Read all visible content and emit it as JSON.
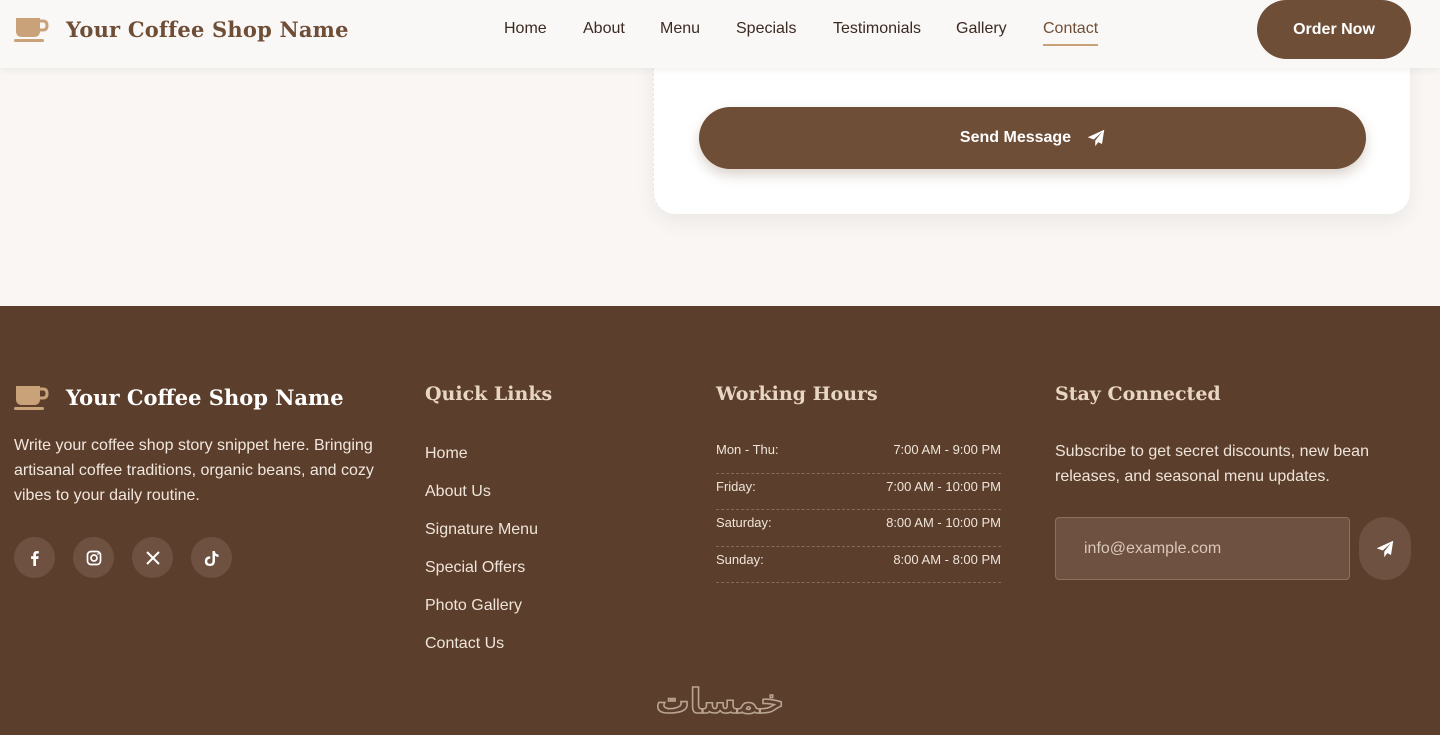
{
  "header": {
    "brand_name": "Your Coffee Shop Name",
    "nav": [
      {
        "label": "Home"
      },
      {
        "label": "About"
      },
      {
        "label": "Menu"
      },
      {
        "label": "Specials"
      },
      {
        "label": "Testimonials"
      },
      {
        "label": "Gallery"
      },
      {
        "label": "Contact",
        "active": true
      }
    ],
    "order_button": "Order Now"
  },
  "contact_form": {
    "send_button": "Send Message"
  },
  "footer": {
    "brand_name": "Your Coffee Shop Name",
    "story": "Write your coffee shop story snippet here. Bringing artisanal coffee traditions, organic beans, and cozy vibes to your daily routine.",
    "socials": [
      "facebook-icon",
      "instagram-icon",
      "x-icon",
      "tiktok-icon"
    ],
    "quick_links": {
      "title": "Quick Links",
      "items": [
        "Home",
        "About Us",
        "Signature Menu",
        "Special Offers",
        "Photo Gallery",
        "Contact Us"
      ]
    },
    "working_hours": {
      "title": "Working Hours",
      "rows": [
        {
          "day": "Mon - Thu:",
          "time": "7:00 AM - 9:00 PM"
        },
        {
          "day": "Friday:",
          "time": "7:00 AM - 10:00 PM"
        },
        {
          "day": "Saturday:",
          "time": "8:00 AM - 10:00 PM"
        },
        {
          "day": "Sunday:",
          "time": "8:00 AM - 8:00 PM"
        }
      ]
    },
    "stay_connected": {
      "title": "Stay Connected",
      "text": "Subscribe to get secret discounts, new bean releases, and seasonal menu updates.",
      "email_placeholder": "info@example.com"
    },
    "watermark": "خمسات"
  },
  "colors": {
    "brand_brown": "#6f4e37",
    "footer_bg": "#5b3e2b",
    "accent_tan": "#c9a27a"
  }
}
